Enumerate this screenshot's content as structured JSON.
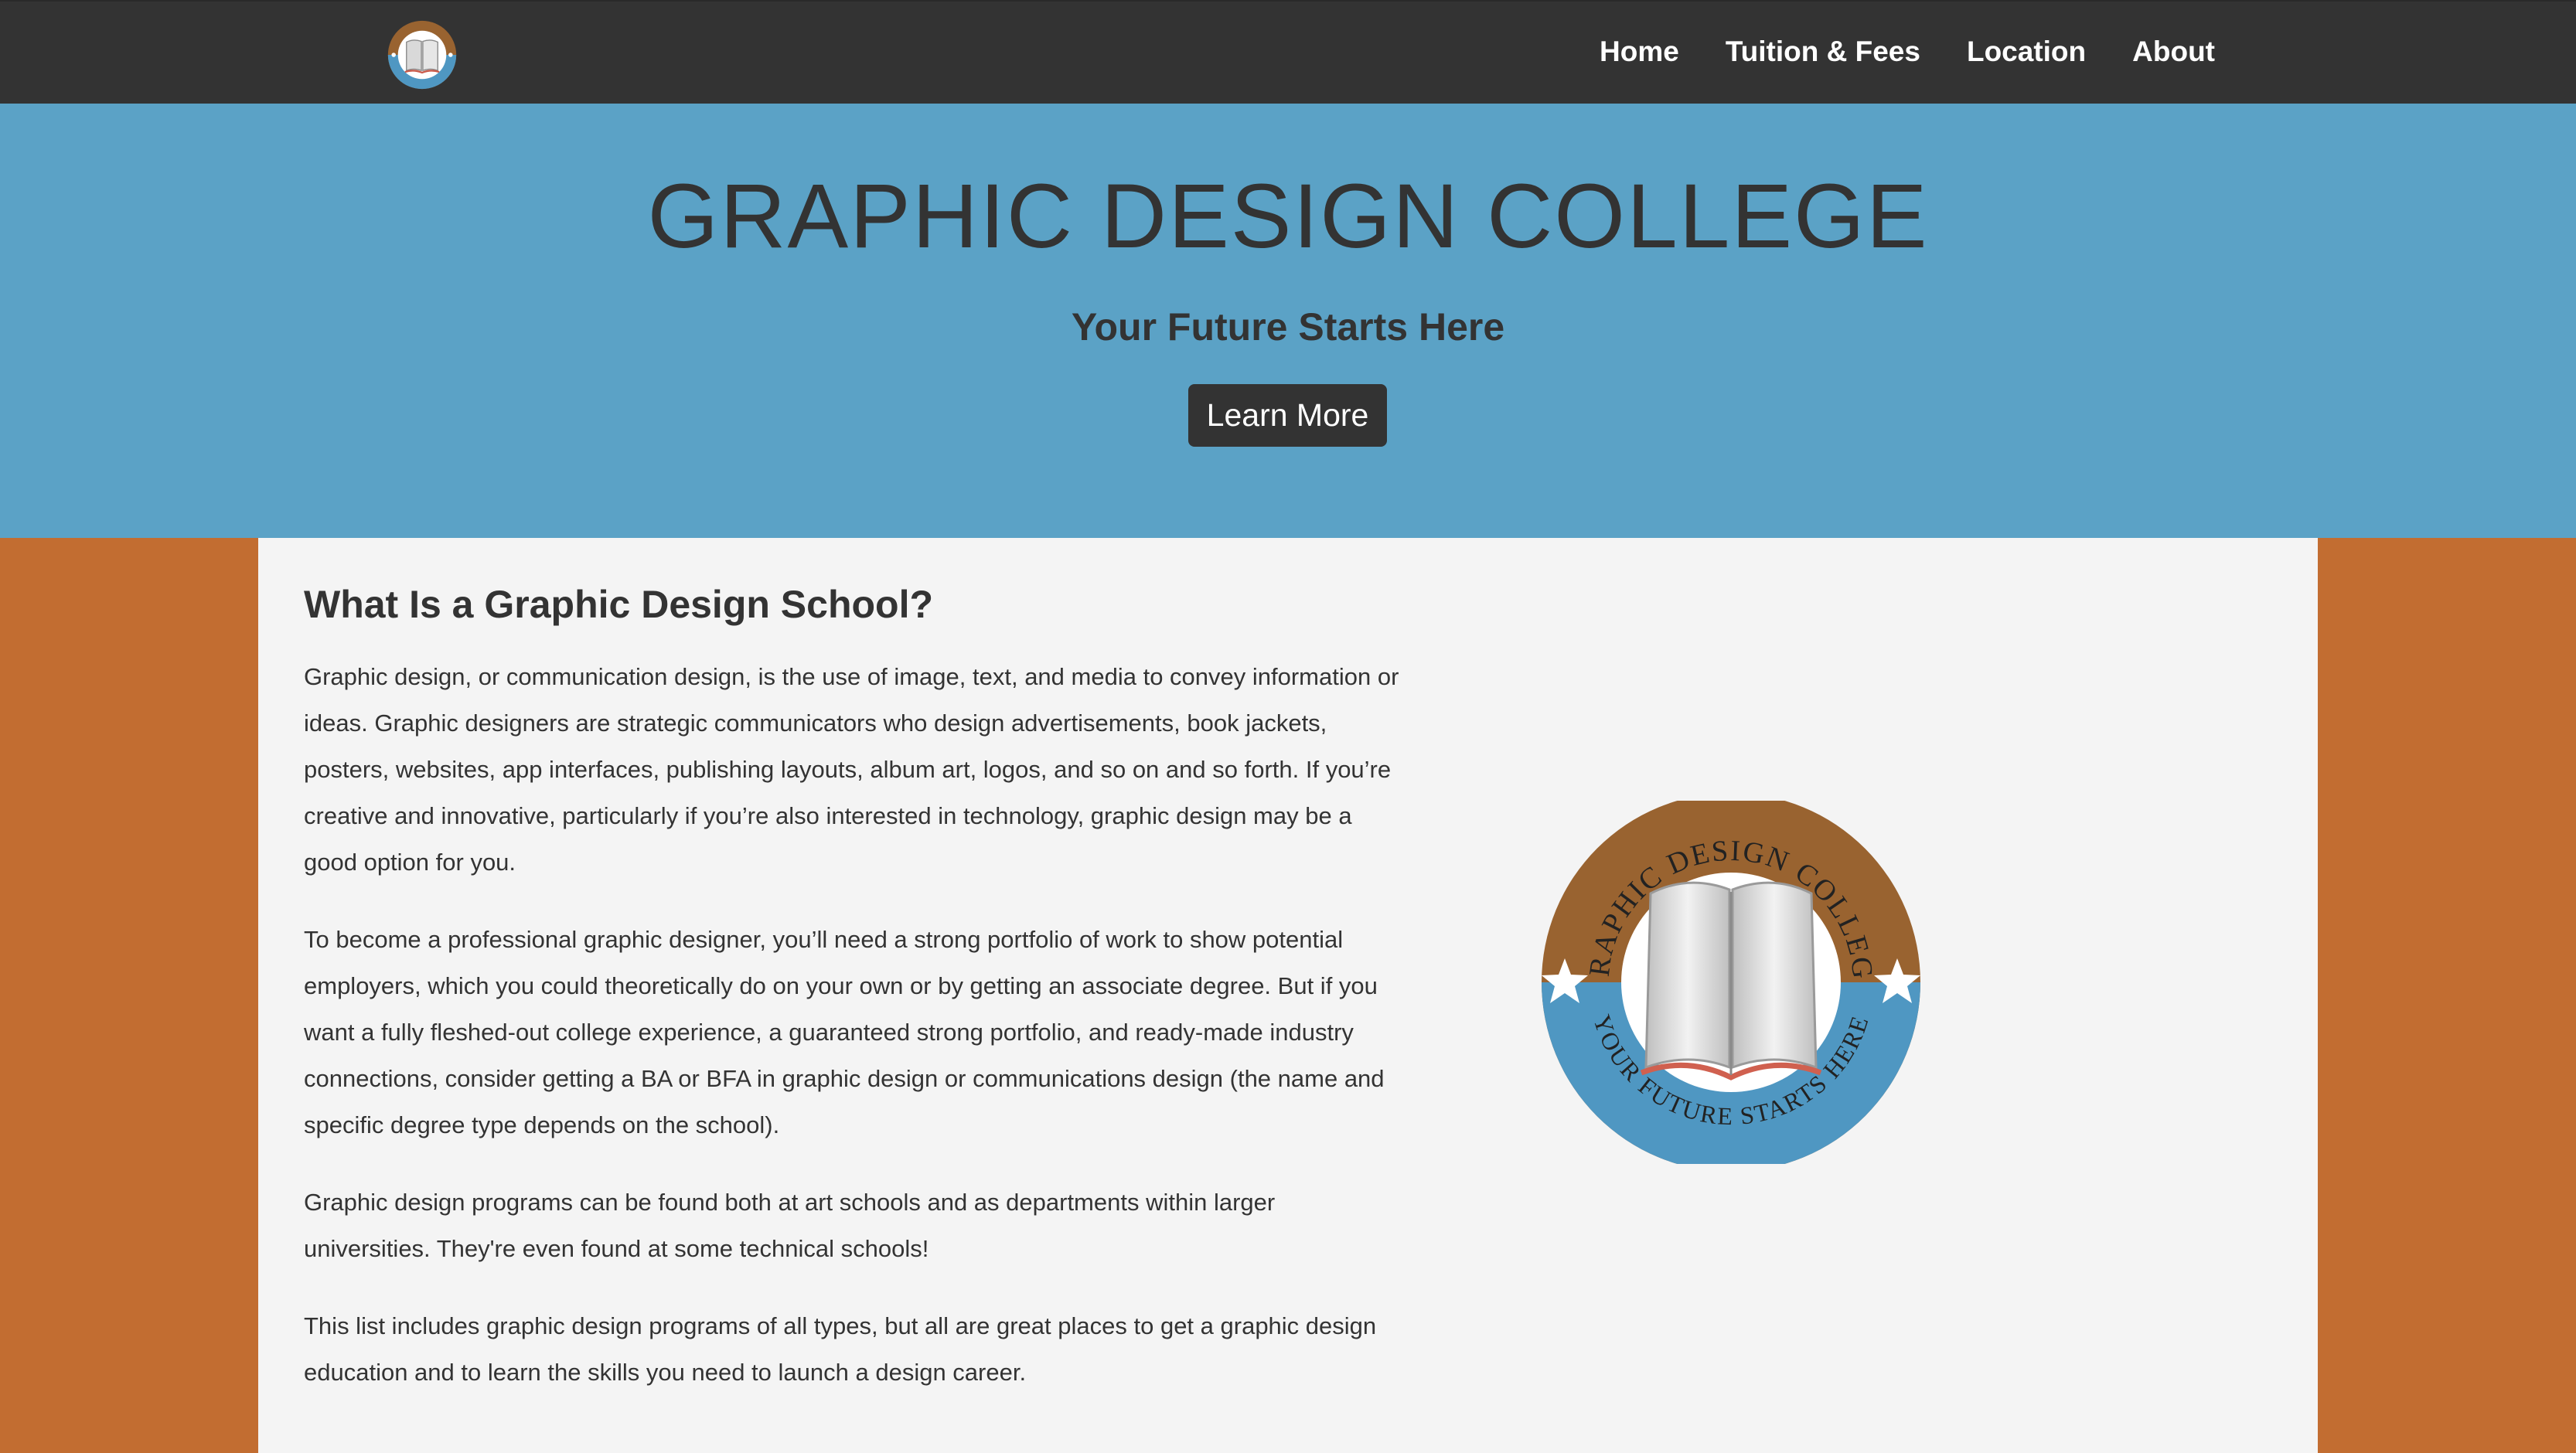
{
  "nav": {
    "logo_icon": "college-seal-logo",
    "links": [
      "Home",
      "Tuition & Fees",
      "Location",
      "About"
    ]
  },
  "hero": {
    "title": "GRAPHIC DESIGN COLLEGE",
    "subtitle": "Your Future Starts Here",
    "button_label": "Learn More"
  },
  "main": {
    "heading": "What Is a Graphic Design School?",
    "paragraphs": [
      "Graphic design, or communication design, is the use of image, text, and media to convey information or ideas. Graphic designers are strategic communicators who design advertisements, book jackets, posters, websites, app interfaces, publishing layouts, album art, logos, and so on and so forth. If you’re creative and innovative, particularly if you’re also interested in technology, graphic design may be a good option for you.",
      "To become a professional graphic designer, you’ll need a strong portfolio of work to show potential employers, which you could theoretically do on your own or by getting an associate degree. But if you want a fully fleshed-out college experience, a guaranteed strong portfolio, and ready-made industry connections, consider getting a BA or BFA in graphic design or communications design (the name and specific degree type depends on the school).",
      "Graphic design programs can be found both at art schools and as departments within larger universities. They're even found at some technical schools!",
      "This list includes graphic design programs of all types, but all are great places to get a graphic design education and to learn the skills you need to launch a design career."
    ],
    "seal": {
      "top_text": "GRAPHIC DESIGN COLLEGE",
      "bottom_text": "YOUR FUTURE STARTS HERE"
    }
  },
  "colors": {
    "navbar": "#333333",
    "hero": "#5ba2c6",
    "page_background": "#c26d31",
    "content_background": "#f4f4f4",
    "seal_brown": "#996330",
    "seal_blue": "#4f97c2"
  }
}
